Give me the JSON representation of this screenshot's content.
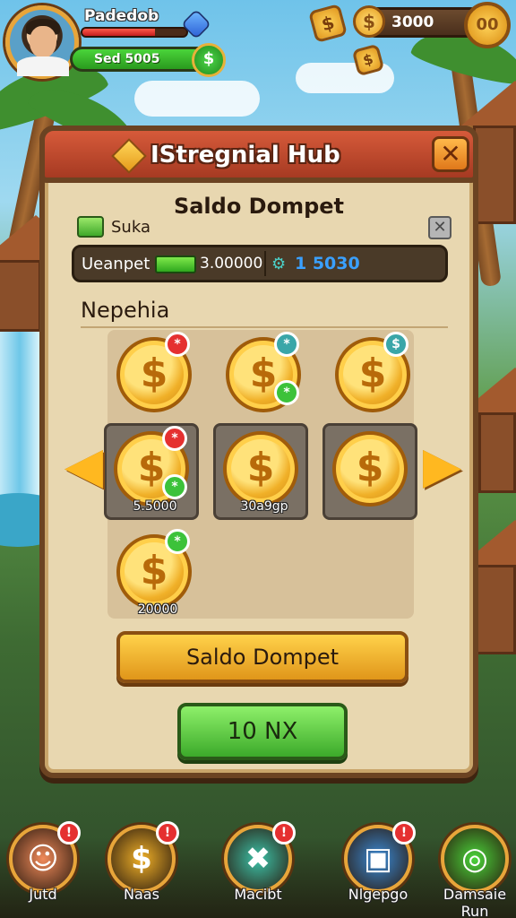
{
  "hud": {
    "player_name": "Padedob",
    "hp_fraction": 0.7,
    "cash": "Sed 5005",
    "gold": "3000",
    "gold_big": "00",
    "cash_coin_symbol": "$",
    "gold_coin_symbol": "$"
  },
  "panel": {
    "title": "IStregnial Hub",
    "close_symbol": "✕",
    "wallet_title": "Saldo Dompet",
    "wallet_user": "Suka",
    "wallet_close_symbol": "✕",
    "wallet_label": "Ueanpet",
    "wallet_value": "3.00000",
    "wallet_bonus": "1 5030",
    "section_label": "Nepehia",
    "coins": [
      {
        "symbol": "$",
        "badges": [
          "*"
        ],
        "badge_colors": [
          "red"
        ],
        "caption": ""
      },
      {
        "symbol": "$",
        "badges": [
          "*",
          "*"
        ],
        "badge_colors": [
          "teal",
          "green"
        ],
        "caption": ""
      },
      {
        "symbol": "$",
        "badges": [
          "$"
        ],
        "badge_colors": [
          "teal"
        ],
        "caption": ""
      },
      {
        "symbol": "$",
        "badges": [
          "*",
          "*"
        ],
        "badge_colors": [
          "red",
          "green"
        ],
        "caption": "5.5000"
      },
      {
        "symbol": "$",
        "badges": [],
        "badge_colors": [],
        "caption": "30a9gp"
      },
      {
        "symbol": "$",
        "badges": [],
        "badge_colors": [],
        "caption": ""
      },
      {
        "symbol": "$",
        "badges": [
          "*"
        ],
        "badge_colors": [
          "green"
        ],
        "caption": "20000"
      }
    ],
    "action_button": "Saldo Dompet",
    "confirm_button": "10 NX"
  },
  "nav": [
    {
      "label": "Jutd",
      "badge": "!",
      "icon": "avatar-icon",
      "color": "#f08a5a"
    },
    {
      "label": "Naas",
      "badge": "!",
      "icon": "coin-icon",
      "color": "#f0b028"
    },
    {
      "label": "Macibt",
      "badge": "!",
      "icon": "tools-icon",
      "color": "#3cc2a8"
    },
    {
      "label": "Nlgepgo",
      "badge": "!",
      "icon": "crate-icon",
      "color": "#3a8ad6"
    },
    {
      "label": "Damsaie Run",
      "badge": "",
      "icon": "run-icon",
      "color": "#4ad43a"
    }
  ],
  "colors": {
    "panel": "#e8d7b0",
    "header": "#c44a2e",
    "accent_gold": "#ffd24a",
    "accent_green": "#3caa2a"
  }
}
